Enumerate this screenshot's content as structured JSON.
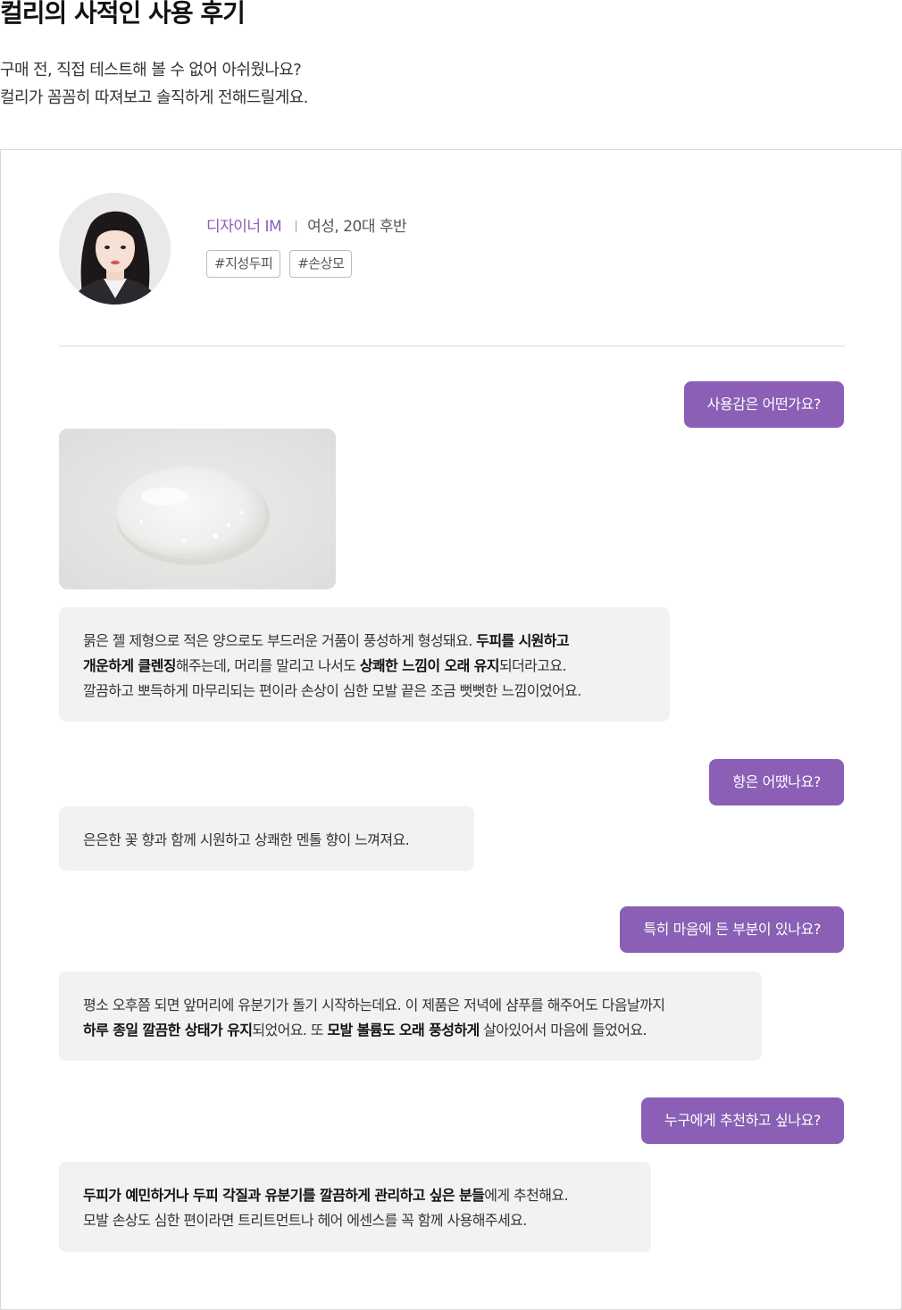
{
  "header": {
    "title": "컬리의 사적인 사용 후기",
    "intro_lines": [
      "구매 전, 직접 테스트해 볼 수 없어 아쉬웠나요?",
      "컬리가 꼼꼼히 따져보고 솔직하게 전해드릴게요."
    ]
  },
  "reviewer": {
    "name": "디자이너 IM",
    "info": "여성, 20대 후반",
    "tags": [
      "#지성두피",
      "#손상모"
    ],
    "accent_color": "#8b5fb8"
  },
  "qa": [
    {
      "question": "사용감은 어떤가요?",
      "answer_lines": [
        [
          {
            "t": "묽은 젤 제형으로 적은 양으로도 부드러운 거품이 풍성하게 형성돼요. "
          },
          {
            "t": "두피를 시원하고",
            "b": true
          }
        ],
        [
          {
            "t": "개운하게 클렌징",
            "b": true
          },
          {
            "t": "해주는데, 머리를 말리고 나서도 "
          },
          {
            "t": "상쾌한 느낌이 오래 유지",
            "b": true
          },
          {
            "t": "되더라고요."
          }
        ],
        [
          {
            "t": "깔끔하고 뽀득하게 마무리되는 편이라 손상이 심한 모발 끝은 조금 뻣뻣한 느낌이었어요."
          }
        ]
      ]
    },
    {
      "question": "향은 어땠나요?",
      "answer_lines": [
        [
          {
            "t": "은은한 꽃 향과 함께 시원하고 상쾌한 멘톨 향이 느껴져요."
          }
        ]
      ]
    },
    {
      "question": "특히 마음에 든 부분이 있나요?",
      "answer_lines": [
        [
          {
            "t": "평소 오후쯤 되면 앞머리에 유분기가 돌기 시작하는데요. 이 제품은 저녁에 샴푸를 해주어도 다음날까지"
          }
        ],
        [
          {
            "t": "하루 종일 깔끔한 상태가 유지",
            "b": true
          },
          {
            "t": "되었어요. 또 "
          },
          {
            "t": "모발 볼륨도 오래 풍성하게",
            "b": true
          },
          {
            "t": " 살아있어서 마음에 들었어요."
          }
        ]
      ]
    },
    {
      "question": "누구에게 추천하고 싶나요?",
      "answer_lines": [
        [
          {
            "t": "두피가 예민하거나 두피 각질과 유분기를 깔끔하게 관리하고 싶은 분들",
            "b": true
          },
          {
            "t": "에게 추천해요."
          }
        ],
        [
          {
            "t": "모발 손상도 심한 편이라면 트리트먼트나 헤어 에센스를 꼭 함께 사용해주세요."
          }
        ]
      ]
    }
  ],
  "colors": {
    "question_bubble": "#8a5fb5",
    "answer_bubble": "#f2f2f2"
  }
}
